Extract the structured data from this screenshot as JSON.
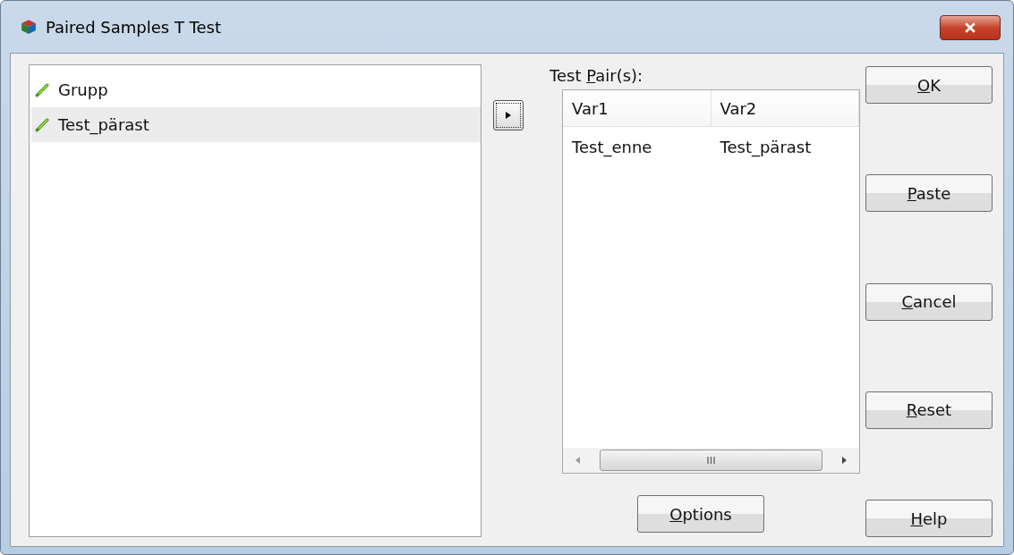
{
  "window": {
    "title": "Paired Samples T Test"
  },
  "variables": [
    {
      "name": "Grupp",
      "selected": false
    },
    {
      "name": "Test_pärast",
      "selected": true
    }
  ],
  "test_pairs": {
    "label": {
      "before": "Test ",
      "mnemonic": "P",
      "after": "air(s):"
    },
    "columns": [
      "Var1",
      "Var2"
    ],
    "rows": [
      [
        "Test_enne",
        "Test_pärast"
      ]
    ]
  },
  "options_button": {
    "mnemonic": "O",
    "after": "ptions"
  },
  "buttons": [
    {
      "mnemonic": "O",
      "after": "K"
    },
    {
      "mnemonic": "P",
      "after": "aste"
    },
    {
      "mnemonic": "C",
      "after": "ancel"
    },
    {
      "mnemonic": "R",
      "after": "eset"
    },
    {
      "mnemonic": "H",
      "after": "elp"
    }
  ]
}
